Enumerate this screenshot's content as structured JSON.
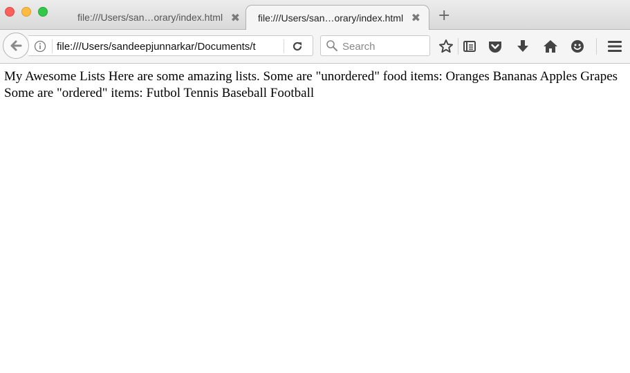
{
  "window": {
    "controls": [
      "close",
      "minimize",
      "zoom"
    ]
  },
  "tabs": [
    {
      "label": "file:///Users/san…orary/index.html",
      "active": false
    },
    {
      "label": "file:///Users/san…orary/index.html",
      "active": true
    }
  ],
  "tab_close_glyph": "✖",
  "new_tab_glyph": "+",
  "navbar": {
    "url": "file:///Users/sandeepjunnarkar/Documents/t",
    "search_placeholder": "Search"
  },
  "icons": {
    "back": "back-arrow-icon",
    "info": "info-icon",
    "reload": "reload-icon",
    "search": "search-icon",
    "bookmark": "star-icon",
    "reading_list": "library-icon",
    "pocket": "pocket-icon",
    "downloads": "download-icon",
    "home": "home-icon",
    "hello": "hello-icon",
    "menu": "hamburger-menu-icon"
  },
  "colors": {
    "close": "#fc605c",
    "minimize": "#fdbc40",
    "zoom": "#34c84a",
    "toolbar_icon": "#444444"
  },
  "page": {
    "text": "My Awesome Lists Here are some amazing lists. Some are \"unordered\" food items: Oranges Bananas Apples Grapes Some are \"ordered\" items: Futbol Tennis Baseball Football"
  }
}
